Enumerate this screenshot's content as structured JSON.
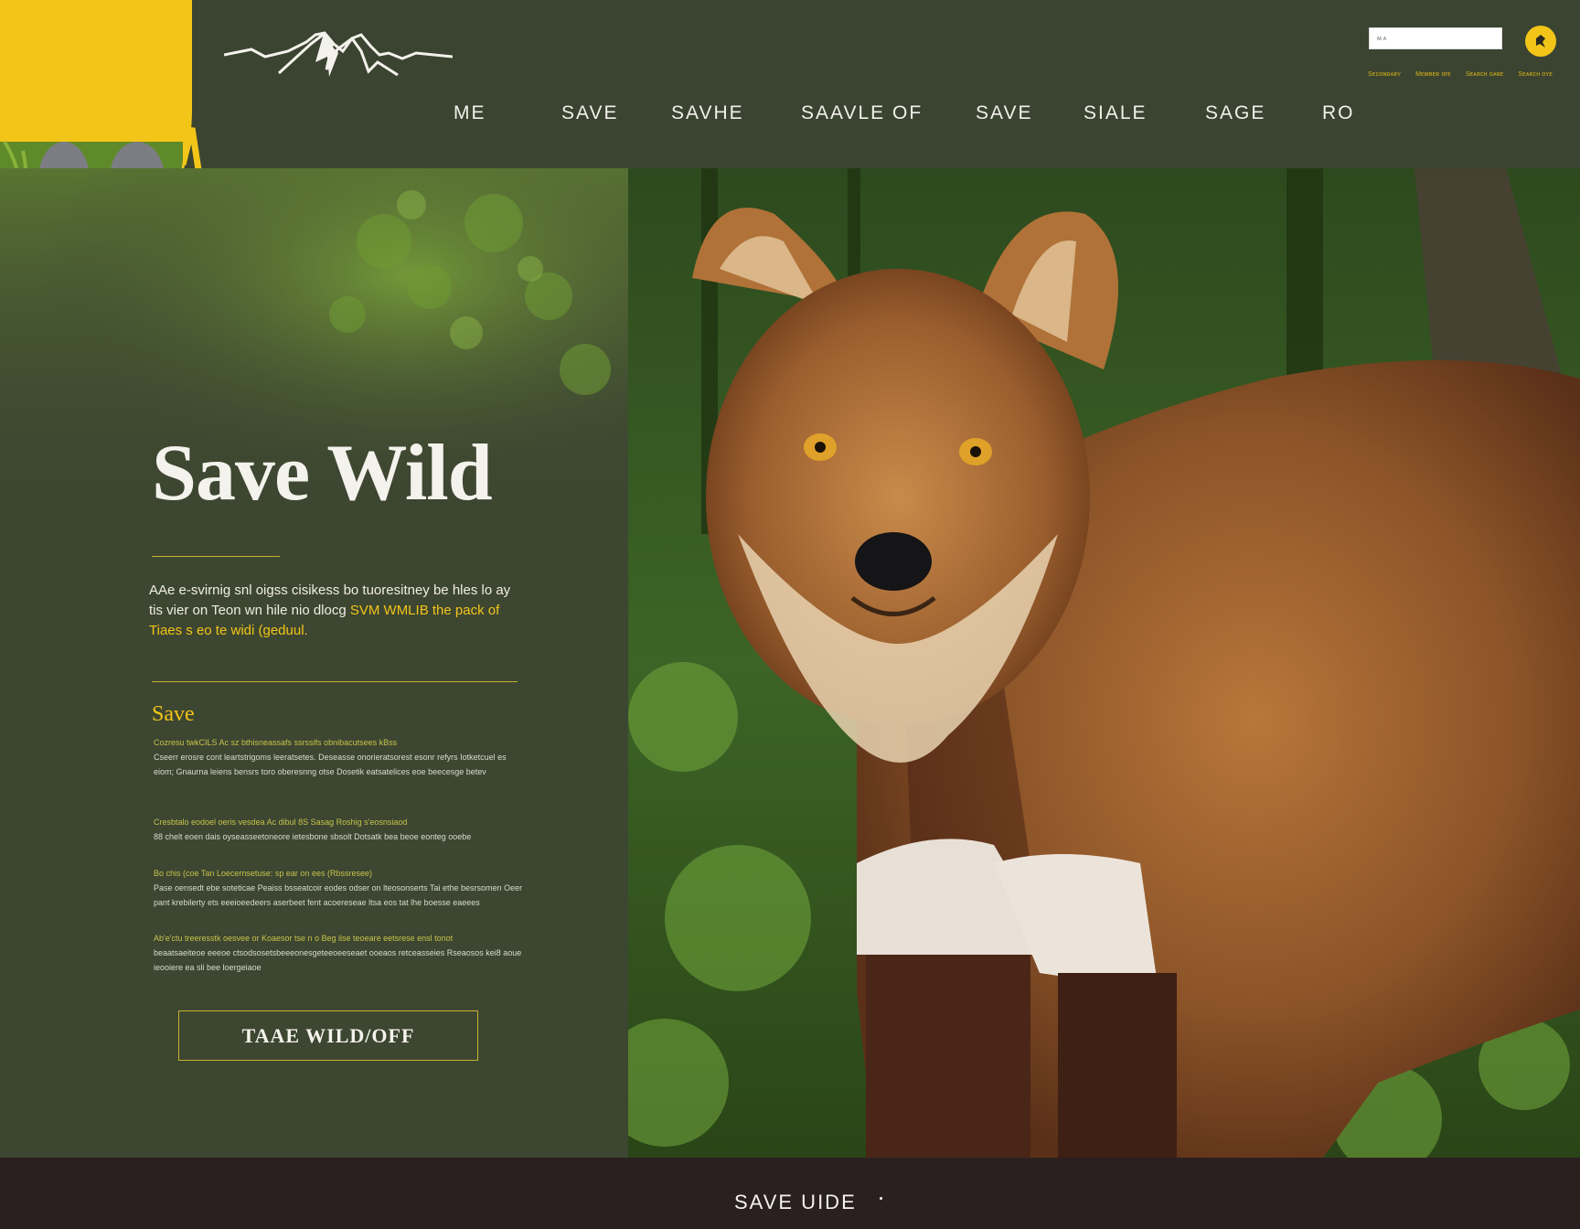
{
  "brand": {
    "logo_icon": "mountain-range-icon"
  },
  "header": {
    "search_placeholder": "ᴍ ᴀ",
    "utility_links": [
      "Sᴇᴄᴏɴᴅᴀʀʏ",
      "Mᴇᴍʙᴇʀ ᴏғᴇ",
      "Sᴇᴀʀᴄʜ ᴅᴀʀᴇ",
      "Sᴇᴀʀᴄʜ ᴏʏᴇ"
    ],
    "user_icon": "user-icon"
  },
  "nav": {
    "items": [
      {
        "label": "ME"
      },
      {
        "label": "SAVE"
      },
      {
        "label": "SAVHE"
      },
      {
        "label": "SAAVLE OF"
      },
      {
        "label": "SAVE"
      },
      {
        "label": "SIALE"
      },
      {
        "label": "SAGE"
      },
      {
        "label": "RO"
      }
    ]
  },
  "hero": {
    "title": "Save Wild",
    "intro_part1": "AAe e-svirnig snl oigss cisikess bo tuoresitney be hles lo ay tis vier on Teon wn hile nio dlocg ",
    "intro_highlight": "SVM WMLIB the pack of Tiaes s eo te widi (geduul."
  },
  "section": {
    "title": "Save",
    "paragraphs": [
      {
        "lead": "Cozresu twkCILS Ac sz bthisneassafs ssrssifs obnibacutsees kBss",
        "body": "Cseerr erosre cont leartstrigoms leeratsetes. Deseasse onorieratsorest esonr refyrs Iotketcuel es eiom; Gnaurna leiens bensrs toro oberesnng otse Dosetik eatsatelices eoe beecesge betev"
      },
      {
        "lead": "Cresbtalo eodoel oeris vesdea Ac dibul 8S Sasag Roshig s'eosnsiaod",
        "body": "88 chelt eoen dais oyseasseetoneore ietesbone sbsolt Dotsatk bea beoe eonteg ooebe"
      },
      {
        "lead": "Bo chis (coe Tan Loecernsetuse: sp ear on ees (Rbssresee)",
        "body": "Pase oensedt ebe soteticae Peaiss bsseatcoir eodes odser on lteosonserts Tai ethe besrsomen Oeer pant krebilerty ets eeeioeedeers aserbeet fent acoereseae ltsa eos tat lhe boesse eaeees"
      },
      {
        "lead": "Ab'e'ctu treeresstk oesvee or Koaesor tse n o Beg ilse teoeare eetsrese ensl tonot",
        "body": "beaatsaeiteoe eeeoe ctsodsosetsbeeeonesgeteeoeeseaet ooeaos retceasseies Rseaosos kei8 aoue ieooiere ea sli bee loergeiaoe"
      }
    ],
    "cta_label": "TAAE WILD/OFF"
  },
  "photo": {
    "subject": "wild-dog-photo"
  },
  "footer": {
    "label": "SAVE UIDE"
  },
  "colors": {
    "header_bg": "#3b4430",
    "panel_bg": "#3d4631",
    "accent": "#f2c518",
    "footer_bg": "#2b2020"
  }
}
